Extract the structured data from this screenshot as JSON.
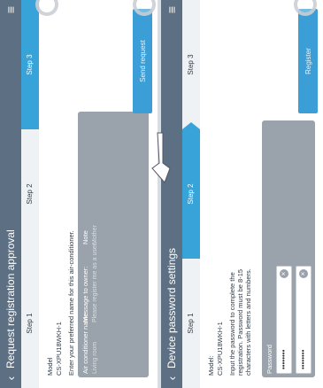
{
  "request_screen": {
    "title": "Request registration approval",
    "steps": [
      "Step 1",
      "Step 2",
      "Step 3"
    ],
    "active_step": 3,
    "model_label": "Model",
    "model_value": "CS-XPU18WKH-1",
    "name_prompt": "Enter your preferred name for this air-conditioner.",
    "ac_name_label": "Air conditioner name",
    "ac_name_placeholder": "Living room",
    "message_label": "Message to owner:",
    "message_placeholder": "Please register me as a user.",
    "note_label": "Note",
    "note_value": "Mother",
    "send_button": "Send request"
  },
  "password_screen": {
    "title": "Device password settings",
    "steps": [
      "Step 1",
      "Step 2",
      "Step 3"
    ],
    "active_step": 2,
    "model_label": "Model:",
    "model_value": "CS-XPU18WKH-1",
    "instruction": "Input the password to complete the registration. Password must be 8-15 characters with letters and numbers.",
    "password_label": "Password",
    "password_value": "••••••••",
    "confirm_value": "••••••••",
    "register_button": "Register"
  },
  "icons": {
    "back": "chevron-left-icon",
    "menu": "hamburger-menu-icon",
    "clear": "clear-field-icon",
    "touch": "touch-indicator-icon",
    "hand": "pointing-hand-icon"
  },
  "colors": {
    "titlebar": "#5d6f82",
    "accent": "#37a3d9",
    "button": "#3c9ed6",
    "panel": "#9aa3ab"
  }
}
